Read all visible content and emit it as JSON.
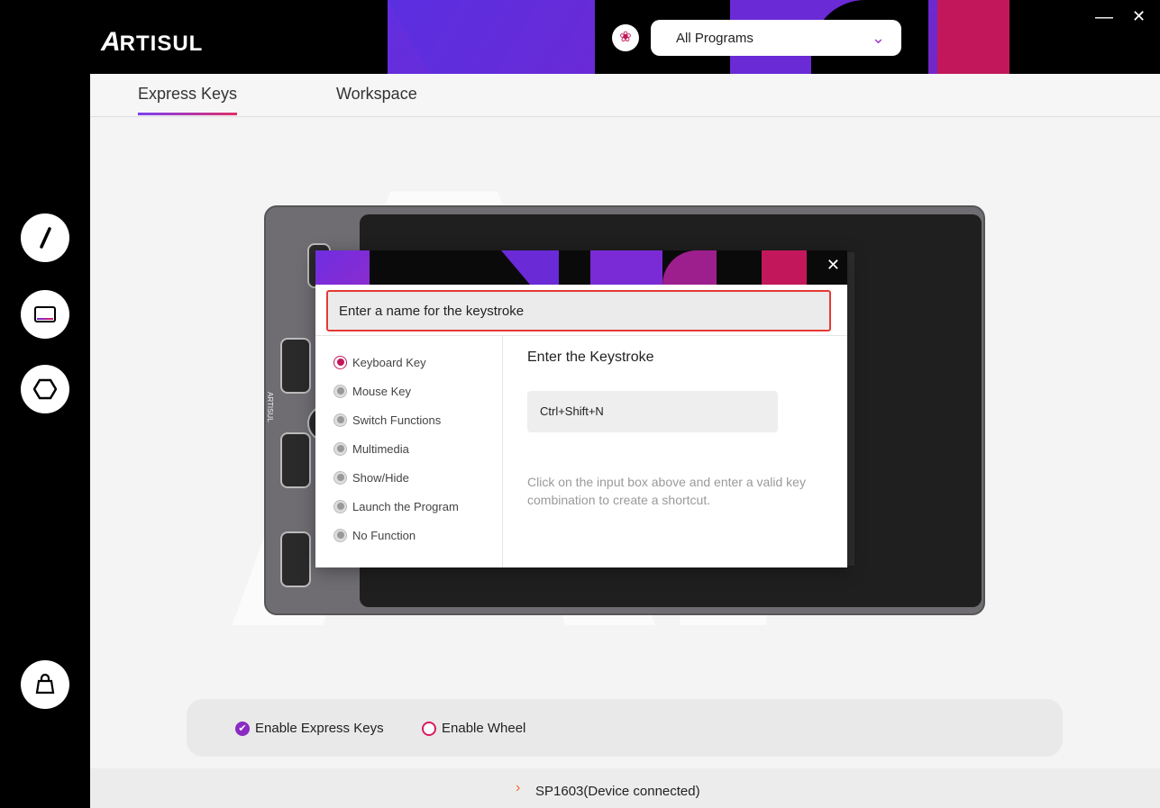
{
  "app": {
    "logo": "RTISUL",
    "logo_a": "A",
    "colors": {
      "accent": "#c2185b",
      "purple": "#6a2ad6",
      "highlight": "#e53935"
    }
  },
  "header": {
    "program_select": {
      "value": "All Programs"
    },
    "minimize": "—",
    "close": "✕"
  },
  "tabs": [
    {
      "label": "Express Keys",
      "active": true
    },
    {
      "label": "Workspace",
      "active": false
    }
  ],
  "sidebar": {
    "tools": [
      {
        "icon": "pen-icon"
      },
      {
        "icon": "tablet-screen-icon"
      },
      {
        "icon": "hexagon-icon"
      },
      {
        "icon": "shop-bag-icon"
      }
    ]
  },
  "device": {
    "brand": "ARTISUL"
  },
  "dialog": {
    "close": "✕",
    "name_placeholder": "Enter a name for the keystroke",
    "options": [
      {
        "label": "Keyboard Key",
        "selected": true
      },
      {
        "label": "Mouse Key",
        "selected": false
      },
      {
        "label": "Switch Functions",
        "selected": false
      },
      {
        "label": "Multimedia",
        "selected": false
      },
      {
        "label": "Show/Hide",
        "selected": false
      },
      {
        "label": "Launch the Program",
        "selected": false
      },
      {
        "label": "No Function",
        "selected": false
      }
    ],
    "keystroke_title": "Enter the Keystroke",
    "keystroke_value": "Ctrl+Shift+N",
    "help_text": "Click on the input box above and  enter a valid key combination to create a shortcut."
  },
  "bottom": {
    "enable_express_keys": "Enable Express Keys",
    "enable_wheel": "Enable Wheel"
  },
  "status": {
    "text": "SP1603(Device connected)"
  }
}
